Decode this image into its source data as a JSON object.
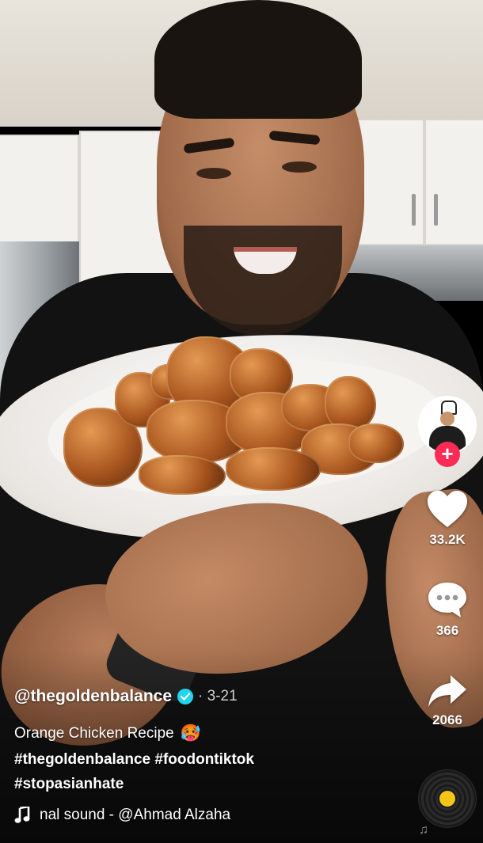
{
  "post": {
    "username": "@thegoldenbalance",
    "date": "· 3-21",
    "description": "Orange Chicken Recipe",
    "description_emoji": "🥵",
    "hashtags_line1": "#thegoldenbalance #foodontiktok",
    "hashtags_line2": "#stopasianhate",
    "sound": "nal sound - @Ahmad Alzaha"
  },
  "actions": {
    "likes": "33.2K",
    "comments": "366",
    "shares": "2066"
  },
  "icons": {
    "avatar": "profile-avatar",
    "follow": "plus-icon",
    "like": "heart-icon",
    "comment": "comment-bubble-icon",
    "share": "share-arrow-icon",
    "music": "music-note-icon",
    "verified": "verified-check-icon",
    "disc": "music-disc-icon"
  },
  "colors": {
    "follow_button": "#fe2c55",
    "verified_badge": "#20d5ec",
    "disc_center": "#f5c518"
  }
}
